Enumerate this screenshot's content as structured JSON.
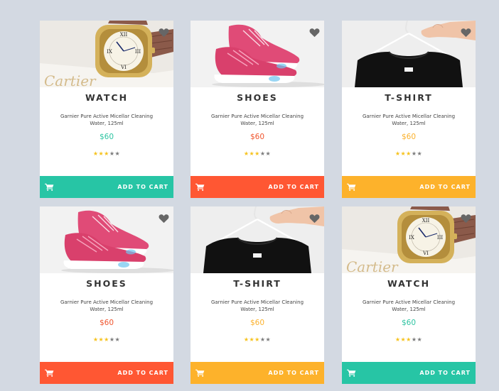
{
  "cards": [
    {
      "title": "WATCH",
      "description": "Garnier Pure Active Micellar Cleaning Water, 125ml",
      "price": "$60",
      "price_color": "#2ec4a2",
      "bar_color": "#27c5a5",
      "add_label": "ADD TO CART",
      "image": "watch",
      "rating": 3,
      "rating_max": 5
    },
    {
      "title": "SHOES",
      "description": "Garnier Pure Active Micellar Cleaning Water, 125ml",
      "price": "$60",
      "price_color": "#f0552e",
      "bar_color": "#ff5733",
      "add_label": "ADD TO CART",
      "image": "shoes",
      "rating": 3,
      "rating_max": 5
    },
    {
      "title": "T-SHIRT",
      "description": "Garnier Pure Active Micellar Cleaning Water, 125ml",
      "price": "$60",
      "price_color": "#fbb12c",
      "bar_color": "#fdb22b",
      "add_label": "ADD TO CART",
      "image": "tshirt",
      "rating": 3,
      "rating_max": 5
    },
    {
      "title": "SHOES",
      "description": "Garnier Pure Active Micellar Cleaning Water, 125ml",
      "price": "$60",
      "price_color": "#f0552e",
      "bar_color": "#ff5733",
      "add_label": "ADD TO CART",
      "image": "shoes",
      "rating": 3,
      "rating_max": 5
    },
    {
      "title": "T-SHIRT",
      "description": "Garnier Pure Active Micellar Cleaning Water, 125ml",
      "price": "$60",
      "price_color": "#fbb12c",
      "bar_color": "#fdb22b",
      "add_label": "ADD TO CART",
      "image": "tshirt",
      "rating": 3,
      "rating_max": 5
    },
    {
      "title": "WATCH",
      "description": "Garnier Pure Active Micellar Cleaning Water, 125ml",
      "price": "$60",
      "price_color": "#2ec4a2",
      "bar_color": "#27c5a5",
      "add_label": "ADD TO CART",
      "image": "watch",
      "rating": 3,
      "rating_max": 5
    }
  ],
  "icons": {
    "favorite": "heart-icon",
    "cart": "shopping-cart-icon",
    "rating": "star-icon"
  }
}
